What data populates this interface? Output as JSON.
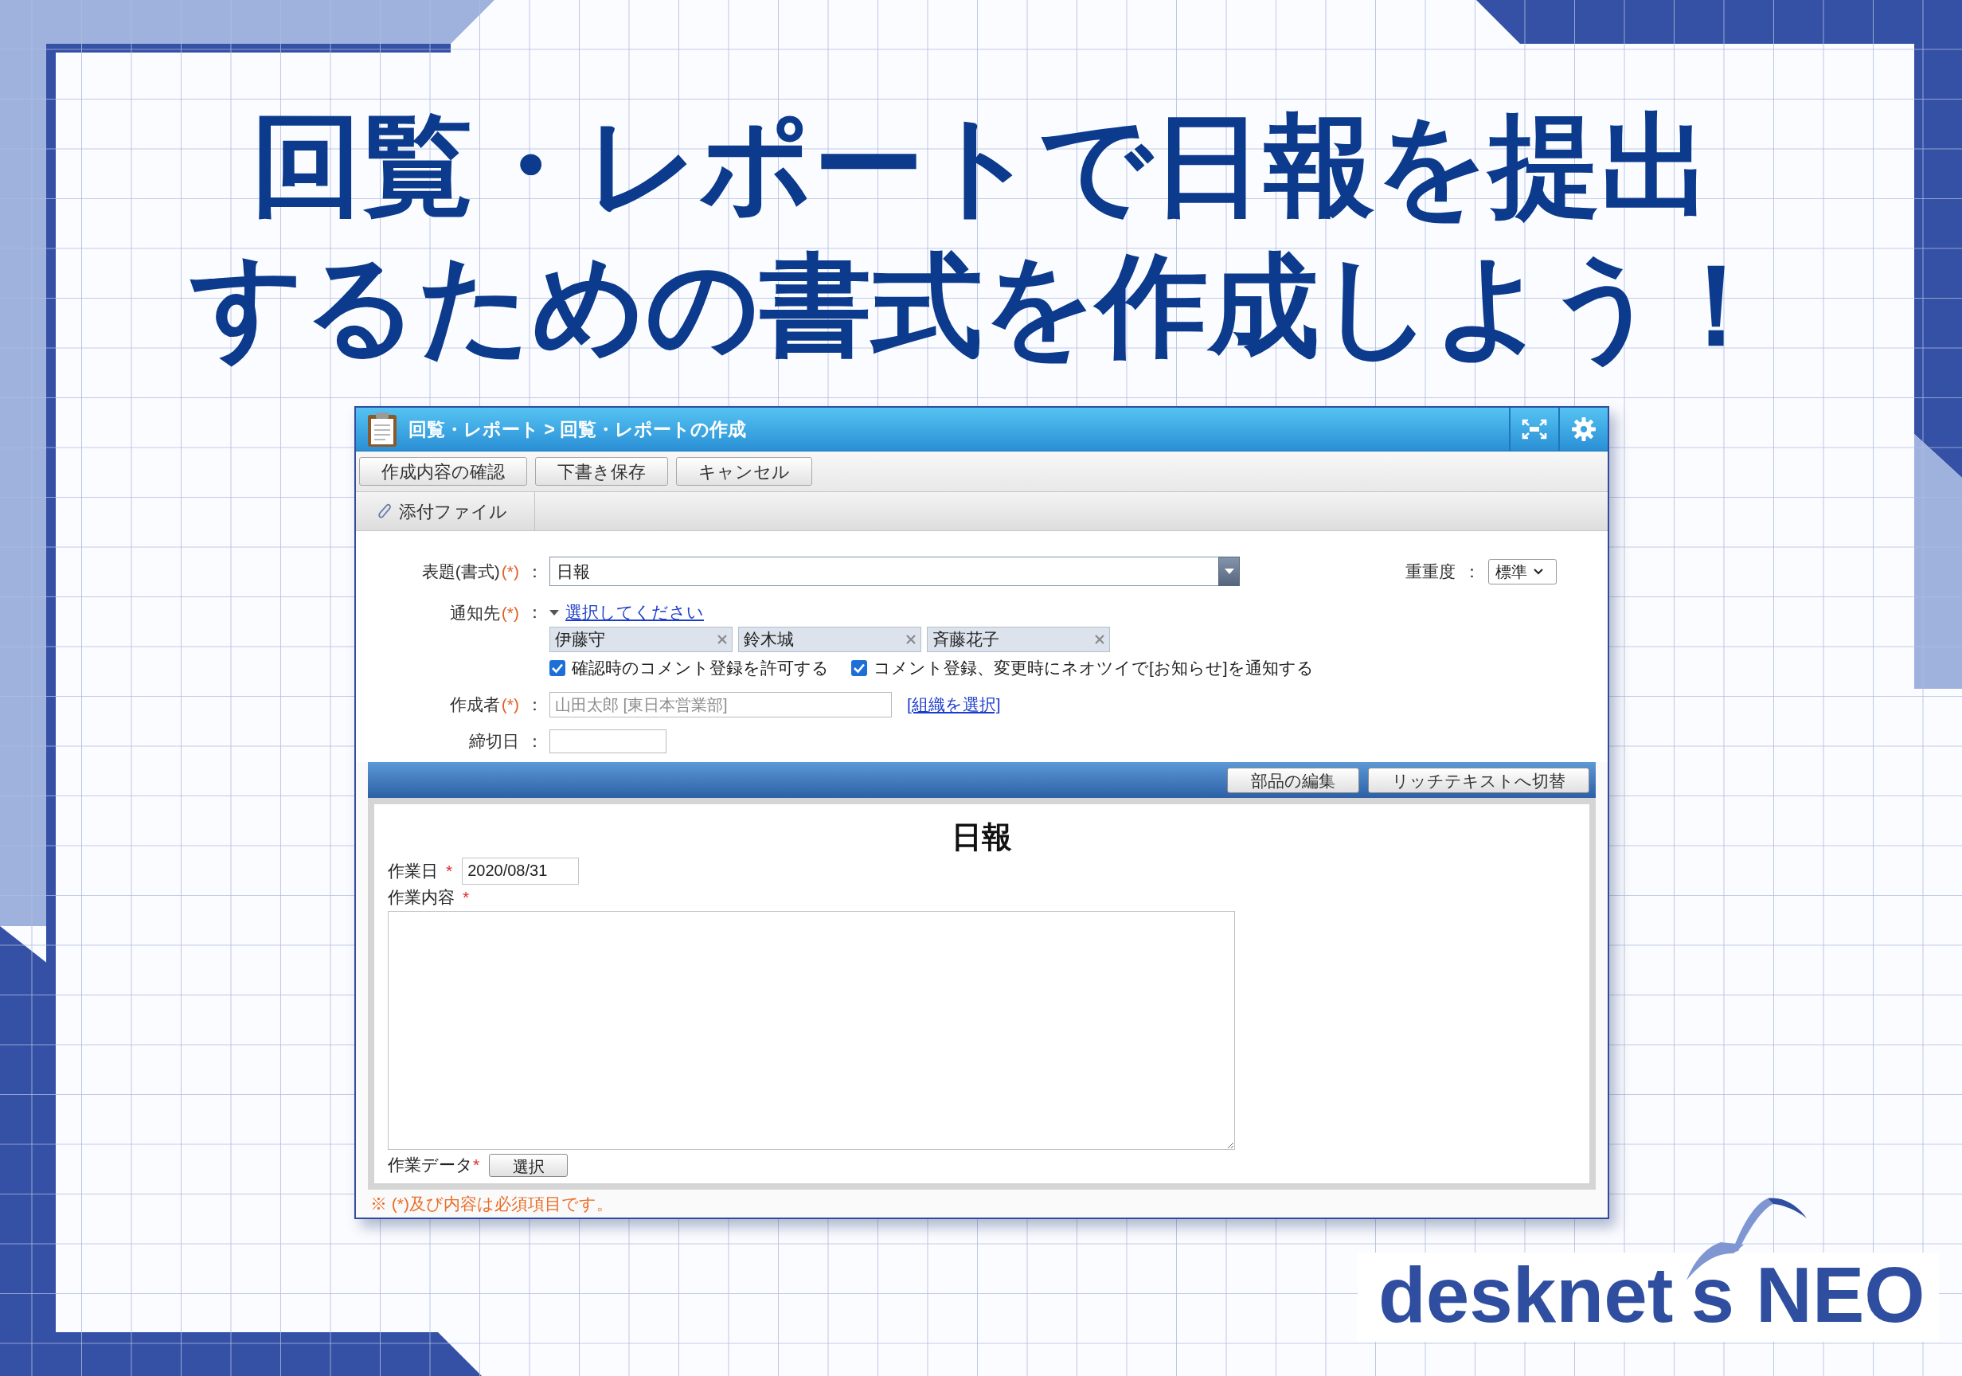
{
  "headline": {
    "lines": [
      "回覧・レポートで日報を提出",
      "するための書式を作成しよう！"
    ]
  },
  "window": {
    "breadcrumb": "回覧・レポート > 回覧・レポートの作成",
    "toolbar": [
      "作成内容の確認",
      "下書き保存",
      "キャンセル"
    ],
    "attachment_tab": "添付ファイル",
    "form": {
      "subject": {
        "label": "表題(書式)",
        "required": "(*)",
        "colon": "：",
        "value": "日報"
      },
      "priority": {
        "label": "重重度",
        "colon": "：",
        "value": "標準"
      },
      "recipients": {
        "label": "通知先",
        "required": "(*)",
        "colon": "：",
        "link": "選択してください",
        "chips": [
          "伊藤守",
          "鈴木城",
          "斉藤花子"
        ],
        "options": [
          {
            "label": "確認時のコメント登録を許可する",
            "checked": true
          },
          {
            "label": "コメント登録、変更時にネオツイで[お知らせ]を通知する",
            "checked": true
          }
        ]
      },
      "author": {
        "label": "作成者",
        "required": "(*)",
        "colon": "：",
        "value": "山田太郎 [東日本営業部]",
        "disabled": true,
        "link": "[組織を選択]"
      },
      "deadline": {
        "label": "締切日",
        "colon": "："
      }
    },
    "editor_buttons": [
      "部品の編集",
      "リッチテキストへ切替"
    ],
    "document": {
      "title": "日報",
      "fields": [
        {
          "kind": "date",
          "label": "作業日",
          "required": "*",
          "value": "2020/08/31"
        },
        {
          "kind": "textarea",
          "label": "作業内容",
          "required": "*"
        },
        {
          "kind": "picker",
          "label": "作業データ",
          "required": "*",
          "button": "選択"
        }
      ]
    },
    "note": "※ (*)及び内容は必須項目です。"
  },
  "logo": {
    "text_before_mark": "desknet",
    "text_after_mark": "s NEO"
  }
}
